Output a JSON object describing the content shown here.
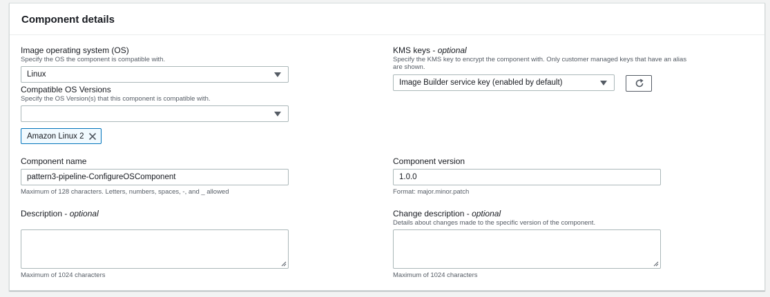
{
  "panel": {
    "title": "Component details"
  },
  "os": {
    "label": "Image operating system (OS)",
    "description": "Specify the OS the component is compatible with.",
    "selected": "Linux"
  },
  "compatible_versions": {
    "label": "Compatible OS Versions",
    "description": "Specify the OS Version(s) that this component is compatible with.",
    "selected": "",
    "tokens": [
      "Amazon Linux 2"
    ]
  },
  "kms": {
    "label": "KMS keys",
    "optional": "optional",
    "separator": " - ",
    "description": "Specify the KMS key to encrypt the component with. Only customer managed keys that have an alias are shown.",
    "selected": "Image Builder service key (enabled by default)"
  },
  "component_name": {
    "label": "Component name",
    "value": "pattern3-pipeline-ConfigureOSComponent",
    "hint": "Maximum of 128 characters. Letters, numbers, spaces, -, and _ allowed"
  },
  "component_version": {
    "label": "Component version",
    "value": "1.0.0",
    "hint": "Format: major.minor.patch"
  },
  "description": {
    "label": "Description",
    "optional": "optional",
    "separator": " - ",
    "value": "",
    "hint": "Maximum of 1024 characters"
  },
  "change_description": {
    "label": "Change description",
    "optional": "optional",
    "separator": " - ",
    "description": "Details about changes made to the specific version of the component.",
    "value": "",
    "hint": "Maximum of 1024 characters"
  },
  "icons": {
    "dropdown": "caret-down-icon",
    "remove": "close-icon",
    "refresh": "refresh-icon",
    "resize": "resize-handle-icon"
  },
  "colors": {
    "token_border": "#0073bb",
    "token_bg": "#f1faff",
    "field_border": "#aab7b8"
  }
}
